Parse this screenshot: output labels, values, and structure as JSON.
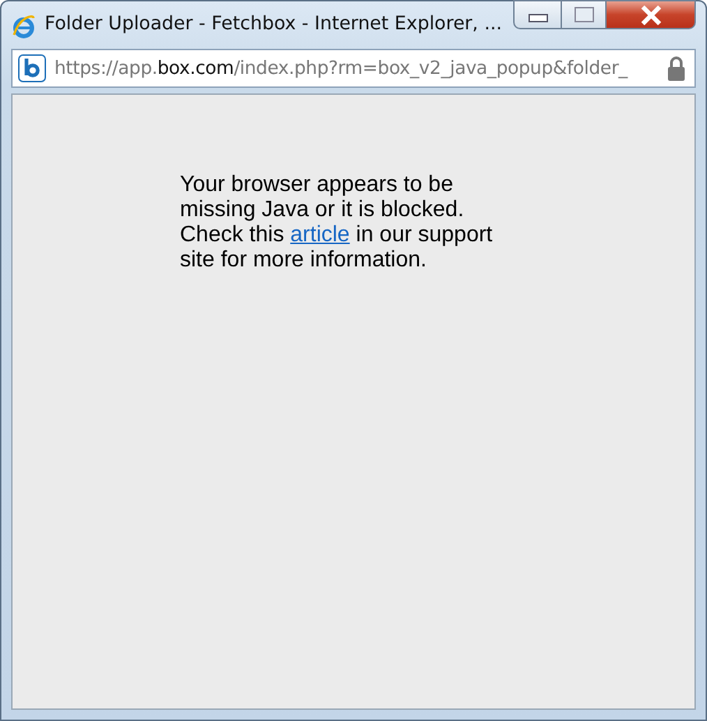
{
  "window": {
    "title": "Folder Uploader - Fetchbox - Internet Explorer, ..."
  },
  "address_bar": {
    "url_start": "https://app.",
    "url_domain": "box.com",
    "url_end": "/index.php?rm=box_v2_java_popup&folder_",
    "secure": true
  },
  "message": {
    "before": "Your browser appears to be missing Java or it is blocked. Check this",
    "link": "article",
    "after": "in our support site for more information."
  }
}
